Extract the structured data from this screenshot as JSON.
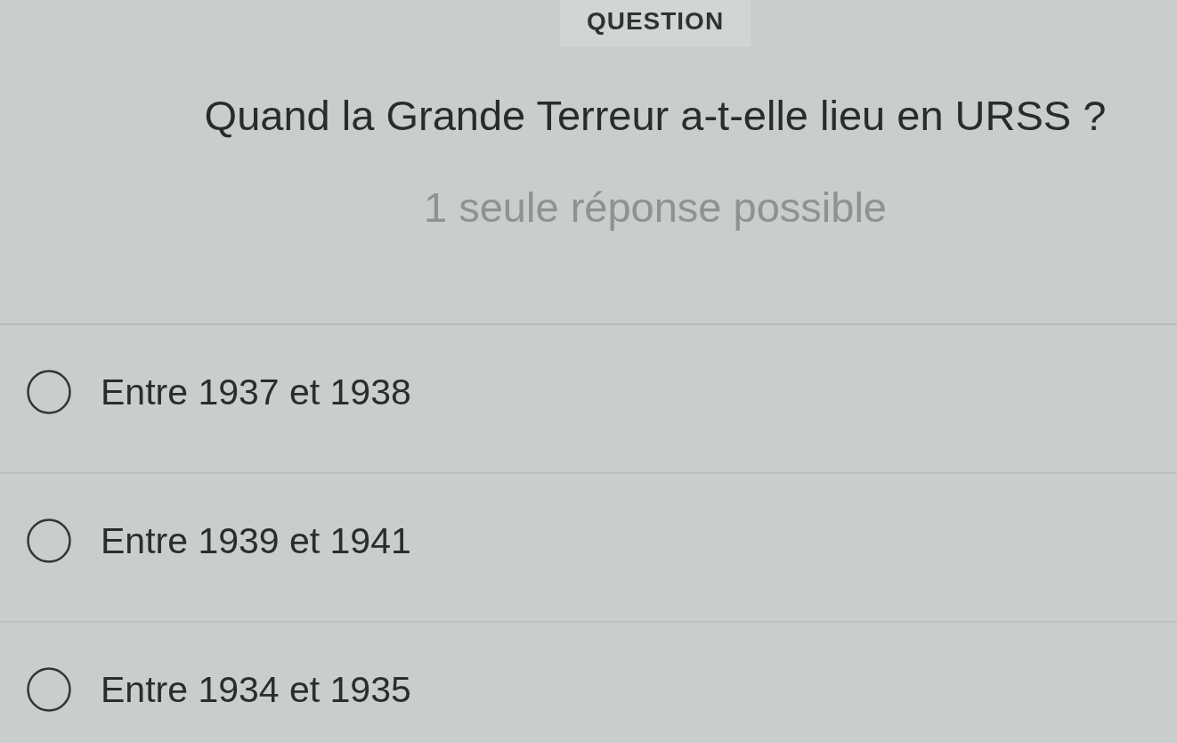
{
  "header": {
    "label": "QUESTION"
  },
  "question": {
    "text": "Quand la Grande Terreur a-t-elle lieu en URSS ?",
    "hint": "1 seule réponse possible"
  },
  "options": [
    {
      "label": "Entre 1937 et 1938",
      "selected": false
    },
    {
      "label": "Entre 1939 et 1941",
      "selected": false
    },
    {
      "label": "Entre 1934 et 1935",
      "selected": false
    }
  ]
}
